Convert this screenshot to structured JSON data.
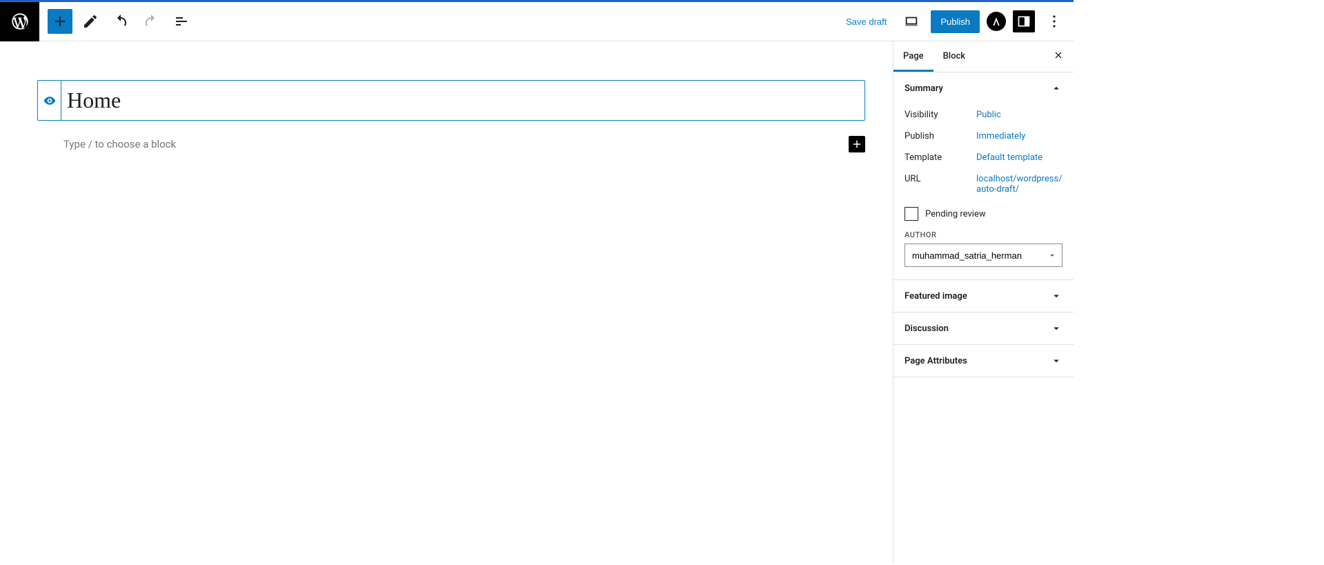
{
  "toolbar": {
    "save_draft": "Save draft",
    "publish": "Publish",
    "astra_initial": "A"
  },
  "editor": {
    "title": "Home",
    "block_placeholder": "Type / to choose a block"
  },
  "sidebar": {
    "tabs": {
      "page": "Page",
      "block": "Block"
    },
    "summary": {
      "heading": "Summary",
      "visibility_label": "Visibility",
      "visibility_value": "Public",
      "publish_label": "Publish",
      "publish_value": "Immediately",
      "template_label": "Template",
      "template_value": "Default template",
      "url_label": "URL",
      "url_value": "localhost/wordpress/auto-draft/",
      "pending_review": "Pending review",
      "author_label": "AUTHOR",
      "author_value": "muhammad_satria_herman"
    },
    "featured_image": "Featured image",
    "discussion": "Discussion",
    "page_attributes": "Page Attributes"
  }
}
